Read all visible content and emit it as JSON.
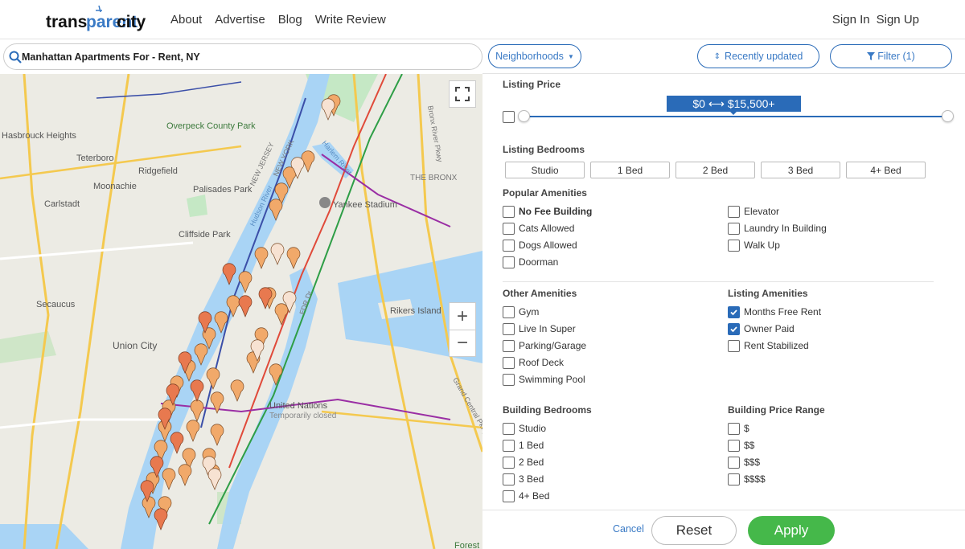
{
  "header": {
    "logo_text": "transparentcity",
    "nav": [
      "About",
      "Advertise",
      "Blog",
      "Write Review"
    ],
    "auth": [
      "Sign In",
      "Sign Up"
    ]
  },
  "search": {
    "value": "Manhattan Apartments For - Rent, NY"
  },
  "toolbar": {
    "neighborhoods": "Neighborhoods",
    "sort": "Recently updated",
    "filter": "Filter (1)"
  },
  "map": {
    "labels": [
      "Overpeck County Park",
      "Hasbrouck Heights",
      "Teterboro",
      "Ridgefield",
      "Moonachie",
      "Palisades Park",
      "Carlstadt",
      "Cliffside Park",
      "Secaucus",
      "Union City",
      "NEW JERSEY",
      "NEW YORK",
      "Yankee Stadium",
      "THE BRONX",
      "Rikers Island",
      "United Nations",
      "Temporarily closed",
      "Grand Central Pkwy",
      "FDR Dr",
      "Hudson River",
      "Harlem River",
      "Bronx River Pkwy",
      "Forest"
    ]
  },
  "filters": {
    "listing_price": {
      "title": "Listing Price",
      "range_label": "$0 ⟷ $15,500+"
    },
    "listing_bedrooms": {
      "title": "Listing Bedrooms",
      "options": [
        "Studio",
        "1 Bed",
        "2 Bed",
        "3 Bed",
        "4+ Bed"
      ]
    },
    "popular_amenities": {
      "title": "Popular Amenities",
      "left": [
        "No Fee Building",
        "Cats Allowed",
        "Dogs Allowed",
        "Doorman"
      ],
      "right": [
        "Elevator",
        "Laundry In Building",
        "Walk Up"
      ]
    },
    "other_amenities": {
      "title": "Other Amenities",
      "items": [
        "Gym",
        "Live In Super",
        "Parking/Garage",
        "Roof Deck",
        "Swimming Pool"
      ]
    },
    "listing_amenities": {
      "title": "Listing Amenities",
      "items": [
        "Months Free Rent",
        "Owner Paid",
        "Rent Stabilized"
      ],
      "checked": [
        true,
        true,
        false
      ]
    },
    "building_bedrooms": {
      "title": "Building Bedrooms",
      "items": [
        "Studio",
        "1 Bed",
        "2 Bed",
        "3 Bed",
        "4+ Bed"
      ]
    },
    "building_price_range": {
      "title": "Building Price Range",
      "items": [
        "$",
        "$$",
        "$$$",
        "$$$$"
      ]
    }
  },
  "footer": {
    "cancel": "Cancel",
    "reset": "Reset",
    "apply": "Apply"
  },
  "colors": {
    "accent": "#2a6bb8",
    "apply": "#45b84a",
    "water": "#a9d4f5",
    "park": "#c5e8c5"
  }
}
